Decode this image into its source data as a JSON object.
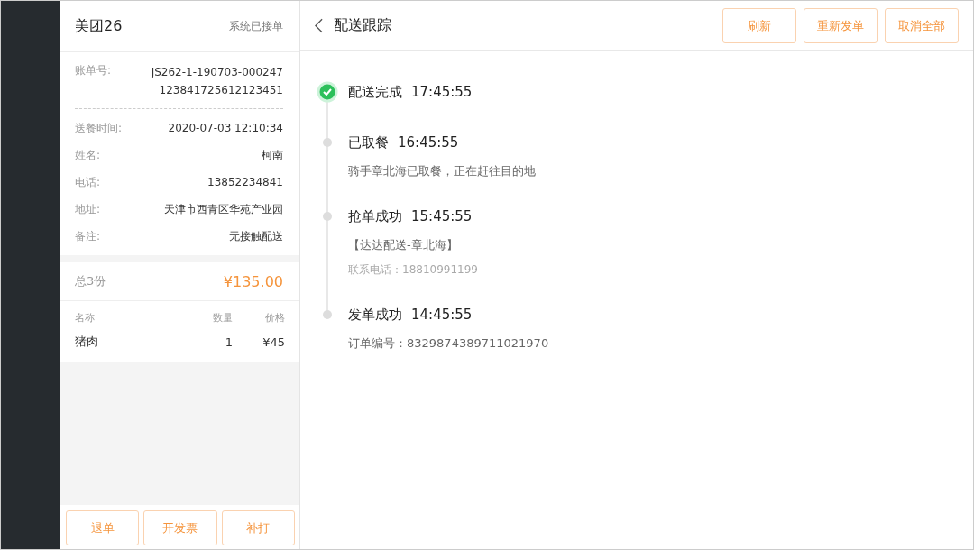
{
  "order": {
    "title": "美团26",
    "status": "系统已接单",
    "bill": {
      "label": "账单号:",
      "value": "JS262-1-190703-000247123841725612123451"
    },
    "fields": [
      {
        "label": "送餐时间:",
        "value": "2020-07-03 12:10:34"
      },
      {
        "label": "姓名:",
        "value": "柯南"
      },
      {
        "label": "电话:",
        "value": "13852234841"
      },
      {
        "label": "地址:",
        "value": "天津市西青区华苑产业园"
      },
      {
        "label": "备注:",
        "value": "无接触配送"
      }
    ],
    "total_label": "总3份",
    "total": "¥135.00",
    "columns": [
      "名称",
      "数量",
      "价格"
    ],
    "items": [
      {
        "name": "猪肉",
        "qty": "1",
        "price": "¥45"
      }
    ],
    "buttons": [
      "退单",
      "开发票",
      "补打"
    ]
  },
  "tracking": {
    "title": "配送跟踪",
    "buttons": [
      "刷新",
      "重新发单",
      "取消全部"
    ],
    "events": [
      {
        "title": "配送完成",
        "time": "17:45:55",
        "done": true
      },
      {
        "title": "已取餐",
        "time": "16:45:55",
        "done": false,
        "lines": [
          {
            "text": "骑手章北海已取餐，正在赶往目的地",
            "kind": "normal"
          }
        ]
      },
      {
        "title": "抢单成功",
        "time": "15:45:55",
        "done": false,
        "lines": [
          {
            "text": "【达达配送-章北海】",
            "kind": "normal"
          },
          {
            "text": "联系电话：18810991199",
            "kind": "muted"
          }
        ]
      },
      {
        "title": "发单成功",
        "time": "14:45:55",
        "done": false,
        "lines": [
          {
            "text": "订单编号：8329874389711021970",
            "kind": "normal"
          }
        ]
      }
    ]
  }
}
